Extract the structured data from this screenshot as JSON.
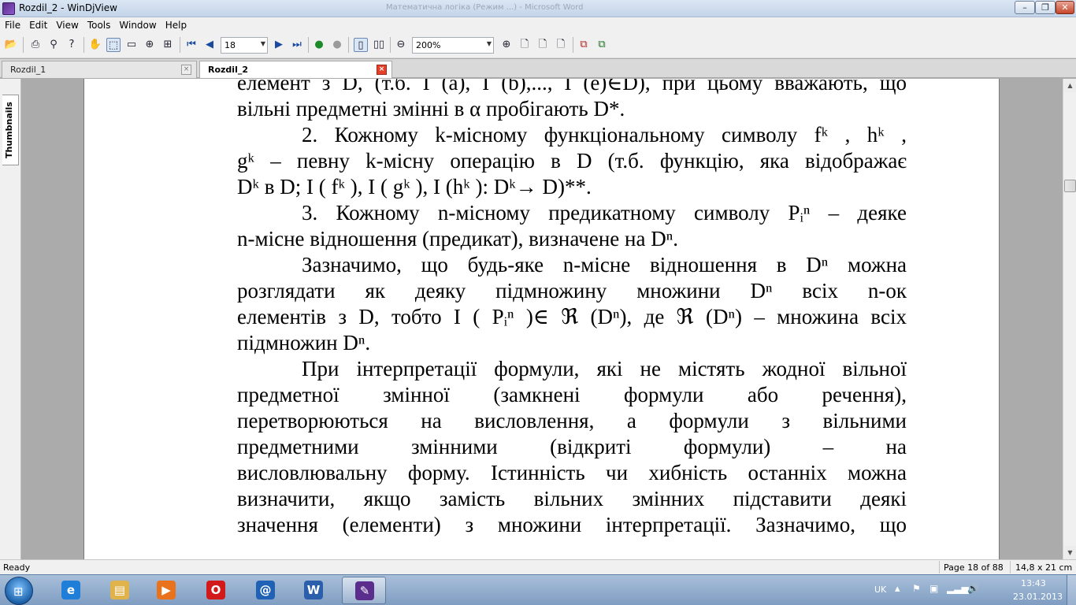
{
  "window": {
    "title": "Rozdil_2 - WinDjView",
    "background_title": "Математична логіка (Режим ...) - Microsoft Word",
    "min_glyph": "–",
    "max_glyph": "❐",
    "close_glyph": "✕"
  },
  "menu": {
    "items": [
      "File",
      "Edit",
      "View",
      "Tools",
      "Window",
      "Help"
    ]
  },
  "toolbar": {
    "page_number": "18",
    "zoom": "200%"
  },
  "tabs": [
    {
      "label": "Rozdil_1",
      "close": "×"
    },
    {
      "label": "Rozdil_2",
      "close": "×"
    }
  ],
  "sidebar": {
    "thumbnails_label": "Thumbnails"
  },
  "document": {
    "lines": [
      {
        "text": "елемент з D, (т.б. I (a), I (b),..., I (e)∈D), при цьому вважають, що",
        "justify": true,
        "indent": false
      },
      {
        "text": "вільні предметні змінні в α пробігають D*.",
        "justify": false,
        "indent": false
      },
      {
        "text": "2. Кожному k-місному функціональному символу  fᵏ , hᵏ ,",
        "justify": true,
        "indent": true
      },
      {
        "text": "gᵏ – певну k-місну операцію в D (т.б. функцію, яка відображає",
        "justify": true,
        "indent": false
      },
      {
        "text": "Dᵏ в D; I ( fᵏ ), I ( gᵏ ), I (hᵏ ): Dᵏ→ D)**.",
        "justify": false,
        "indent": false
      },
      {
        "text": "3. Кожному n-місному предикатному символу  Pᵢⁿ  – деяке",
        "justify": true,
        "indent": true
      },
      {
        "text": "n-місне відношення (предикат), визначене на Dⁿ.",
        "justify": false,
        "indent": false
      },
      {
        "text": "Зазначимо, що будь-яке n-місне відношення в Dⁿ можна",
        "justify": true,
        "indent": true
      },
      {
        "text": "розглядати як деяку підмножину множини Dⁿ всіх n-ок",
        "justify": true,
        "indent": false
      },
      {
        "text": "елементів з D, тобто I ( Pᵢⁿ )∈  ℜ (Dⁿ), де  ℜ (Dⁿ) – множина всіх",
        "justify": true,
        "indent": false
      },
      {
        "text": "підмножин Dⁿ.",
        "justify": false,
        "indent": false
      },
      {
        "text": "При інтерпретації формули, які не містять жодної вільної",
        "justify": true,
        "indent": true
      },
      {
        "text": "предметної змінної (замкнені формули або речення),",
        "justify": true,
        "indent": false
      },
      {
        "text": "перетворюються на висловлення, а формули з вільними",
        "justify": true,
        "indent": false
      },
      {
        "text": "предметними змінними (відкриті формули) – на",
        "justify": true,
        "indent": false
      },
      {
        "text": "висловлювальну форму. Істинність чи хибність останніх можна",
        "justify": true,
        "indent": false
      },
      {
        "text": "визначити, якщо замість вільних змінних підставити деякі",
        "justify": true,
        "indent": false
      },
      {
        "text": "значення (елементи) з множини інтерпретації. Зазначимо, що",
        "justify": true,
        "indent": false
      }
    ]
  },
  "status": {
    "ready": "Ready",
    "page": "Page 18 of 88",
    "size": "14,8 x 21 cm"
  },
  "taskbar": {
    "start_glyph": "⊞",
    "apps": [
      {
        "name": "internet-explorer",
        "glyph": "e",
        "color": "#1f7fd8",
        "active": false
      },
      {
        "name": "file-explorer",
        "glyph": "▤",
        "color": "#e0b24a",
        "active": false
      },
      {
        "name": "media-player",
        "glyph": "▶",
        "color": "#e8731c",
        "active": false
      },
      {
        "name": "opera",
        "glyph": "O",
        "color": "#d21a1a",
        "active": false
      },
      {
        "name": "mail",
        "glyph": "@",
        "color": "#1f62b5",
        "active": false
      },
      {
        "name": "word",
        "glyph": "W",
        "color": "#2b5eab",
        "active": false
      },
      {
        "name": "windjview",
        "glyph": "✎",
        "color": "#5b2d8c",
        "active": true
      }
    ],
    "tray": {
      "lang": "UK",
      "time": "13:43",
      "date": "23.01.2013"
    }
  }
}
